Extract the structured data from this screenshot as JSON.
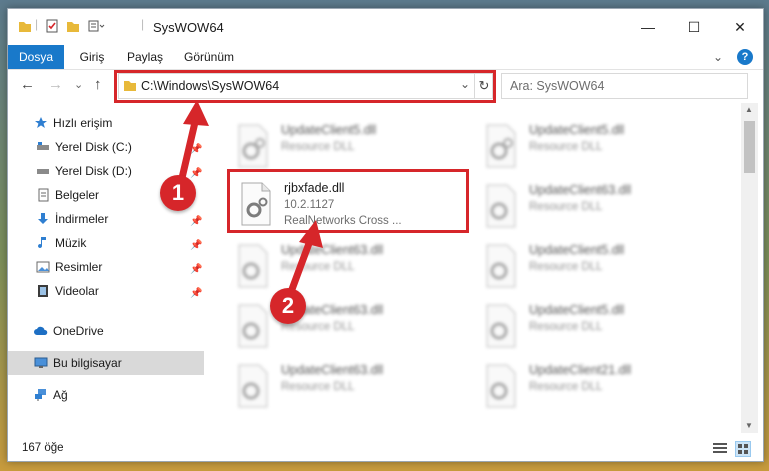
{
  "window": {
    "title": "SysWOW64",
    "minimize": "—",
    "maximize": "☐",
    "close": "✕"
  },
  "ribbon": {
    "tabs": [
      "Dosya",
      "Giriş",
      "Paylaş",
      "Görünüm"
    ],
    "expand": "⌄",
    "help": "?"
  },
  "navbar": {
    "back": "←",
    "forward": "→",
    "recent": "⌄",
    "up": "↑",
    "address": "C:\\Windows\\SysWOW64",
    "address_dropdown": "⌄",
    "refresh": "↻",
    "search_placeholder": "Ara: SysWOW64"
  },
  "sidebar": {
    "quick_access": "Hızlı erişim",
    "items": [
      {
        "label": "Yerel Disk (C:)",
        "icon": "drive-icon"
      },
      {
        "label": "Yerel Disk (D:)",
        "icon": "drive-icon"
      },
      {
        "label": "Belgeler",
        "icon": "documents-icon"
      },
      {
        "label": "İndirmeler",
        "icon": "downloads-icon"
      },
      {
        "label": "Müzik",
        "icon": "music-icon"
      },
      {
        "label": "Resimler",
        "icon": "pictures-icon"
      },
      {
        "label": "Videolar",
        "icon": "videos-icon"
      }
    ],
    "onedrive": "OneDrive",
    "this_pc": "Bu bilgisayar",
    "network": "Ağ",
    "pin": "📌"
  },
  "files": [
    {
      "name": "UpdateClient5.dll",
      "type": "Resource DLL",
      "version": "",
      "blurred": true
    },
    {
      "name": "UpdateClient5.dll",
      "type": "Resource DLL",
      "version": "",
      "blurred": true
    },
    {
      "name": "rjbxfade.dll",
      "version": "10.2.1127",
      "type": "RealNetworks Cross ...",
      "blurred": false
    },
    {
      "name": "UpdateClient63.dll",
      "type": "Resource DLL",
      "version": "",
      "blurred": true
    },
    {
      "name": "UpdateClient63.dll",
      "type": "Resource DLL",
      "version": "",
      "blurred": true
    },
    {
      "name": "UpdateClient5.dll",
      "type": "Resource DLL",
      "version": "",
      "blurred": true
    },
    {
      "name": "UpdateClient63.dll",
      "type": "Resource DLL",
      "version": "",
      "blurred": true
    },
    {
      "name": "UpdateClient5.dll",
      "type": "Resource DLL",
      "version": "",
      "blurred": true
    },
    {
      "name": "UpdateClient63.dll",
      "type": "Resource DLL",
      "version": "",
      "blurred": true
    },
    {
      "name": "UpdateClient21.dll",
      "type": "Resource DLL",
      "version": "",
      "blurred": true
    }
  ],
  "status": {
    "item_count": "167 öğe"
  },
  "annotations": {
    "step1": "1",
    "step2": "2",
    "color": "#d6262a"
  },
  "colors": {
    "accent": "#1979ca"
  }
}
